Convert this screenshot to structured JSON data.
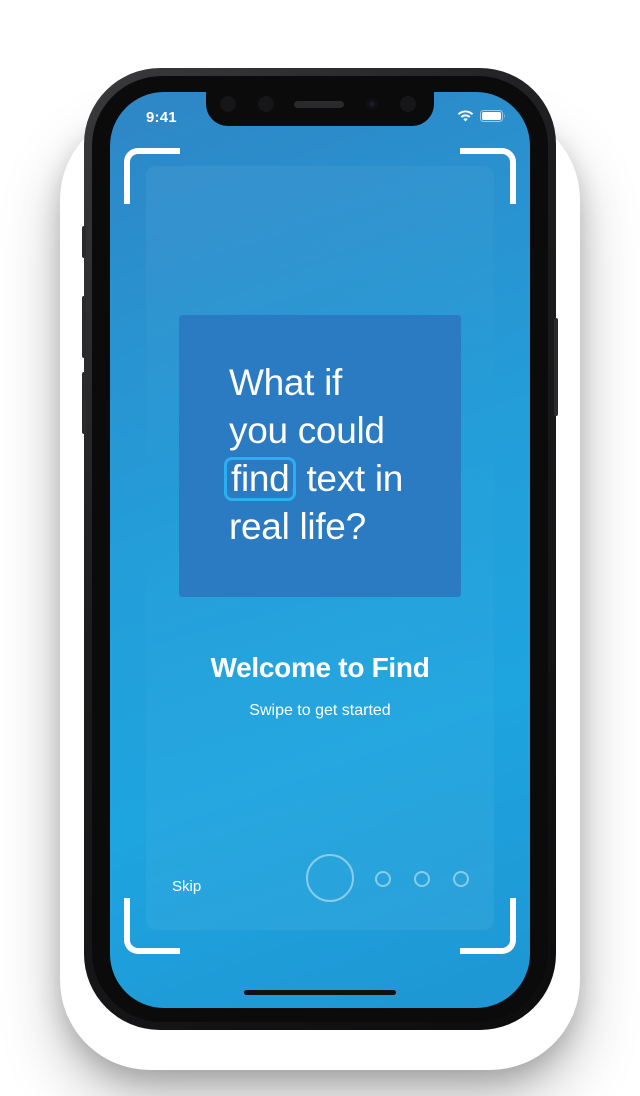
{
  "status_bar": {
    "time": "9:41",
    "icons": [
      "wifi-icon",
      "battery-icon"
    ]
  },
  "colors": {
    "background": "#1ea4df",
    "card": "#2a7bc2",
    "highlight_border": "#2ab0f0",
    "text": "#ffffff"
  },
  "card": {
    "lines": [
      "What if",
      "you could"
    ],
    "highlighted_word": "find",
    "line3_rest": " text in",
    "line4": "real life?"
  },
  "welcome": {
    "title": "Welcome to Find",
    "subtitle": "Swipe to get started"
  },
  "controls": {
    "skip_label": "Skip",
    "pages_total": 4,
    "current_page": 1
  }
}
